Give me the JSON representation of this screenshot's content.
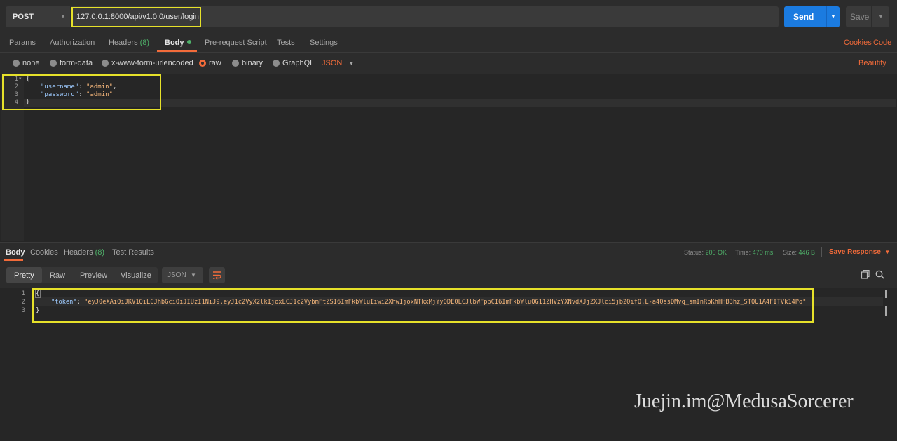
{
  "request": {
    "method": "POST",
    "url": "127.0.0.1:8000/api/v1.0.0/user/login",
    "send_label": "Send",
    "save_label": "Save"
  },
  "request_tabs": {
    "params": "Params",
    "authorization": "Authorization",
    "headers": "Headers",
    "headers_count": "(8)",
    "body": "Body",
    "prerequest": "Pre-request Script",
    "tests": "Tests",
    "settings": "Settings",
    "cookies": "Cookies",
    "code": "Code"
  },
  "body_types": {
    "none": "none",
    "form_data": "form-data",
    "urlencoded": "x-www-form-urlencoded",
    "raw": "raw",
    "binary": "binary",
    "graphql": "GraphQL",
    "format": "JSON",
    "beautify": "Beautify",
    "selected": "raw"
  },
  "request_body": {
    "line_numbers": [
      "1",
      "2",
      "3",
      "4"
    ],
    "open_brace": "{",
    "username_key": "\"username\"",
    "username_value": "\"admin\"",
    "password_key": "\"password\"",
    "password_value": "\"admin\"",
    "close_brace": "}"
  },
  "response_tabs": {
    "body": "Body",
    "cookies": "Cookies",
    "headers": "Headers",
    "headers_count": "(8)",
    "test_results": "Test Results"
  },
  "response_status": {
    "status_label": "Status:",
    "status_value": "200 OK",
    "time_label": "Time:",
    "time_value": "470 ms",
    "size_label": "Size:",
    "size_value": "446 B",
    "save_response": "Save Response"
  },
  "response_view": {
    "pretty": "Pretty",
    "raw": "Raw",
    "preview": "Preview",
    "visualize": "Visualize",
    "format": "JSON"
  },
  "response_body": {
    "line_numbers": [
      "1",
      "2",
      "3"
    ],
    "open_brace": "{",
    "token_key": "\"token\"",
    "token_value": "\"eyJ0eXAiOiJKV1QiLCJhbGciOiJIUzI1NiJ9.eyJ1c2VyX2lkIjoxLCJ1c2VybmFtZSI6ImFkbWluIiwiZXhwIjoxNTkxMjYyODE0LCJlbWFpbCI6ImFkbWluQG11ZHVzYXNvdXJjZXJlci5jb20ifQ.L-a40ssDMvq_smInRpKhHHB3hz_STQU1A4FITVk14Po\"",
    "close_brace": "}"
  },
  "watermark": "Juejin.im@MedusaSorcerer",
  "colors": {
    "accent": "#f26b3a",
    "send": "#1b7be0",
    "highlight": "#e6e12a",
    "status_ok": "#4fb26a"
  }
}
